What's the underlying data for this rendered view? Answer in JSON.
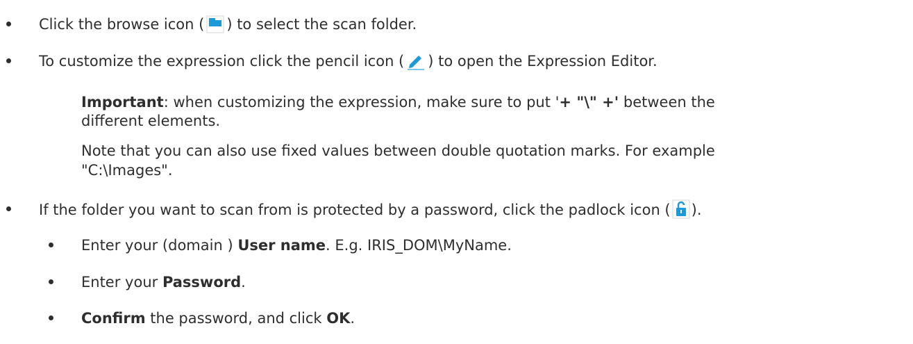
{
  "bullets": {
    "browse": {
      "before": "Click the browse icon (",
      "icon": "folder-icon",
      "after": ") to select the scan folder."
    },
    "pencil": {
      "before": "To customize the expression click the pencil icon (",
      "icon": "pencil-icon",
      "after": ") to open the Expression Editor."
    },
    "padlock": {
      "before": "If the folder you want to scan from is protected by a password, click the padlock icon (",
      "icon": "padlock-icon",
      "after": ")."
    }
  },
  "important": {
    "label": "Important",
    "text1": ": when customizing the expression, make sure to put '",
    "code": "+ \"\\\" +'",
    "text2": " between the",
    "line2": "different elements."
  },
  "note": {
    "line1": "Note that you can also use fixed values between double quotation marks. For example",
    "line2": "\"C:\\Images\"."
  },
  "sub_bullets": {
    "user": {
      "before": "Enter your (domain ) ",
      "bold": "User name",
      "after": ". E.g. IRIS_DOM\\MyName."
    },
    "password": {
      "before": "Enter your ",
      "bold": "Password",
      "after": "."
    },
    "confirm": {
      "bold1": "Confirm",
      "middle": " the password, and click ",
      "bold2": "OK",
      "after": "."
    }
  },
  "colors": {
    "icon_blue": "#1c9ad6",
    "text": "#2e2e2e"
  }
}
